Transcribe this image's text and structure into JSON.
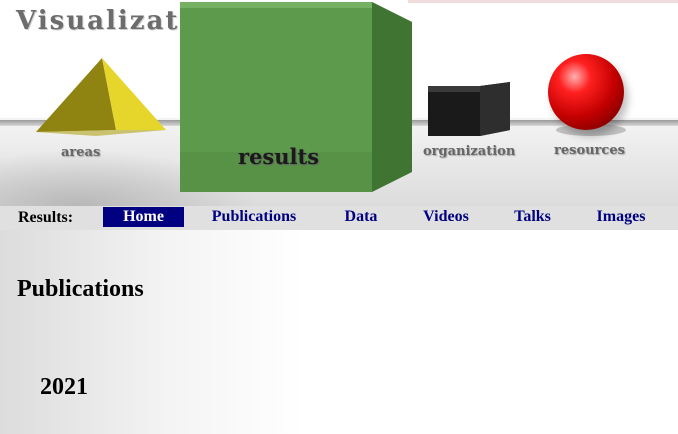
{
  "banner": {
    "title": "Visualizatio",
    "shapes": {
      "areas": "areas",
      "results": "results",
      "organization": "organization",
      "resources": "resources"
    }
  },
  "nav": {
    "prefix": "Results:",
    "items": [
      {
        "label": "Home",
        "active": true
      },
      {
        "label": "Publications",
        "active": false
      },
      {
        "label": "Data",
        "active": false
      },
      {
        "label": "Videos",
        "active": false
      },
      {
        "label": "Talks",
        "active": false
      },
      {
        "label": "Images",
        "active": false
      }
    ],
    "active_bg": "#000080",
    "link_color": "#000080"
  },
  "main": {
    "heading": "Publications",
    "year": "2021"
  },
  "colors": {
    "pyramid": "#d4c21e",
    "results_cube": "#5a9a48",
    "org_cube": "#111111",
    "sphere": "#e01010"
  }
}
